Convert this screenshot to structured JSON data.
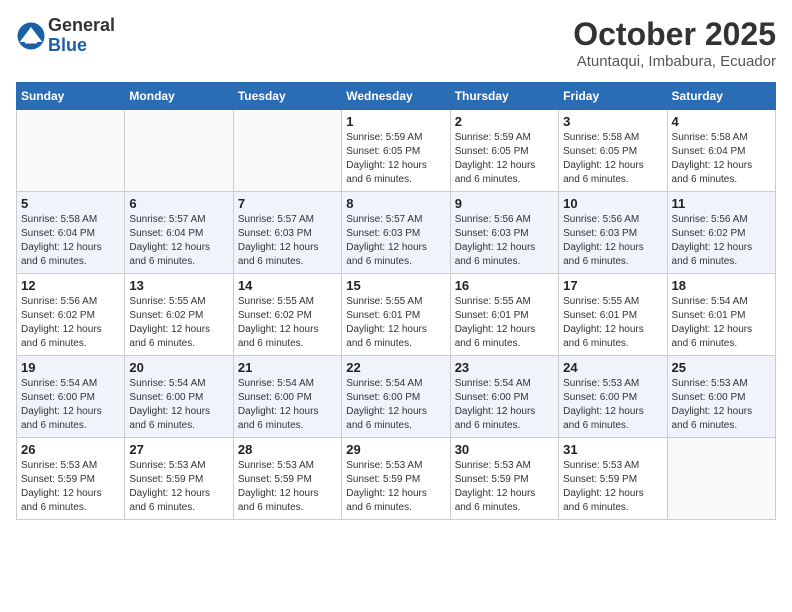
{
  "logo": {
    "general": "General",
    "blue": "Blue"
  },
  "header": {
    "month": "October 2025",
    "location": "Atuntaqui, Imbabura, Ecuador"
  },
  "weekdays": [
    "Sunday",
    "Monday",
    "Tuesday",
    "Wednesday",
    "Thursday",
    "Friday",
    "Saturday"
  ],
  "weeks": [
    [
      {
        "day": "",
        "info": ""
      },
      {
        "day": "",
        "info": ""
      },
      {
        "day": "",
        "info": ""
      },
      {
        "day": "1",
        "info": "Sunrise: 5:59 AM\nSunset: 6:05 PM\nDaylight: 12 hours\nand 6 minutes."
      },
      {
        "day": "2",
        "info": "Sunrise: 5:59 AM\nSunset: 6:05 PM\nDaylight: 12 hours\nand 6 minutes."
      },
      {
        "day": "3",
        "info": "Sunrise: 5:58 AM\nSunset: 6:05 PM\nDaylight: 12 hours\nand 6 minutes."
      },
      {
        "day": "4",
        "info": "Sunrise: 5:58 AM\nSunset: 6:04 PM\nDaylight: 12 hours\nand 6 minutes."
      }
    ],
    [
      {
        "day": "5",
        "info": "Sunrise: 5:58 AM\nSunset: 6:04 PM\nDaylight: 12 hours\nand 6 minutes."
      },
      {
        "day": "6",
        "info": "Sunrise: 5:57 AM\nSunset: 6:04 PM\nDaylight: 12 hours\nand 6 minutes."
      },
      {
        "day": "7",
        "info": "Sunrise: 5:57 AM\nSunset: 6:03 PM\nDaylight: 12 hours\nand 6 minutes."
      },
      {
        "day": "8",
        "info": "Sunrise: 5:57 AM\nSunset: 6:03 PM\nDaylight: 12 hours\nand 6 minutes."
      },
      {
        "day": "9",
        "info": "Sunrise: 5:56 AM\nSunset: 6:03 PM\nDaylight: 12 hours\nand 6 minutes."
      },
      {
        "day": "10",
        "info": "Sunrise: 5:56 AM\nSunset: 6:03 PM\nDaylight: 12 hours\nand 6 minutes."
      },
      {
        "day": "11",
        "info": "Sunrise: 5:56 AM\nSunset: 6:02 PM\nDaylight: 12 hours\nand 6 minutes."
      }
    ],
    [
      {
        "day": "12",
        "info": "Sunrise: 5:56 AM\nSunset: 6:02 PM\nDaylight: 12 hours\nand 6 minutes."
      },
      {
        "day": "13",
        "info": "Sunrise: 5:55 AM\nSunset: 6:02 PM\nDaylight: 12 hours\nand 6 minutes."
      },
      {
        "day": "14",
        "info": "Sunrise: 5:55 AM\nSunset: 6:02 PM\nDaylight: 12 hours\nand 6 minutes."
      },
      {
        "day": "15",
        "info": "Sunrise: 5:55 AM\nSunset: 6:01 PM\nDaylight: 12 hours\nand 6 minutes."
      },
      {
        "day": "16",
        "info": "Sunrise: 5:55 AM\nSunset: 6:01 PM\nDaylight: 12 hours\nand 6 minutes."
      },
      {
        "day": "17",
        "info": "Sunrise: 5:55 AM\nSunset: 6:01 PM\nDaylight: 12 hours\nand 6 minutes."
      },
      {
        "day": "18",
        "info": "Sunrise: 5:54 AM\nSunset: 6:01 PM\nDaylight: 12 hours\nand 6 minutes."
      }
    ],
    [
      {
        "day": "19",
        "info": "Sunrise: 5:54 AM\nSunset: 6:00 PM\nDaylight: 12 hours\nand 6 minutes."
      },
      {
        "day": "20",
        "info": "Sunrise: 5:54 AM\nSunset: 6:00 PM\nDaylight: 12 hours\nand 6 minutes."
      },
      {
        "day": "21",
        "info": "Sunrise: 5:54 AM\nSunset: 6:00 PM\nDaylight: 12 hours\nand 6 minutes."
      },
      {
        "day": "22",
        "info": "Sunrise: 5:54 AM\nSunset: 6:00 PM\nDaylight: 12 hours\nand 6 minutes."
      },
      {
        "day": "23",
        "info": "Sunrise: 5:54 AM\nSunset: 6:00 PM\nDaylight: 12 hours\nand 6 minutes."
      },
      {
        "day": "24",
        "info": "Sunrise: 5:53 AM\nSunset: 6:00 PM\nDaylight: 12 hours\nand 6 minutes."
      },
      {
        "day": "25",
        "info": "Sunrise: 5:53 AM\nSunset: 6:00 PM\nDaylight: 12 hours\nand 6 minutes."
      }
    ],
    [
      {
        "day": "26",
        "info": "Sunrise: 5:53 AM\nSunset: 5:59 PM\nDaylight: 12 hours\nand 6 minutes."
      },
      {
        "day": "27",
        "info": "Sunrise: 5:53 AM\nSunset: 5:59 PM\nDaylight: 12 hours\nand 6 minutes."
      },
      {
        "day": "28",
        "info": "Sunrise: 5:53 AM\nSunset: 5:59 PM\nDaylight: 12 hours\nand 6 minutes."
      },
      {
        "day": "29",
        "info": "Sunrise: 5:53 AM\nSunset: 5:59 PM\nDaylight: 12 hours\nand 6 minutes."
      },
      {
        "day": "30",
        "info": "Sunrise: 5:53 AM\nSunset: 5:59 PM\nDaylight: 12 hours\nand 6 minutes."
      },
      {
        "day": "31",
        "info": "Sunrise: 5:53 AM\nSunset: 5:59 PM\nDaylight: 12 hours\nand 6 minutes."
      },
      {
        "day": "",
        "info": ""
      }
    ]
  ]
}
